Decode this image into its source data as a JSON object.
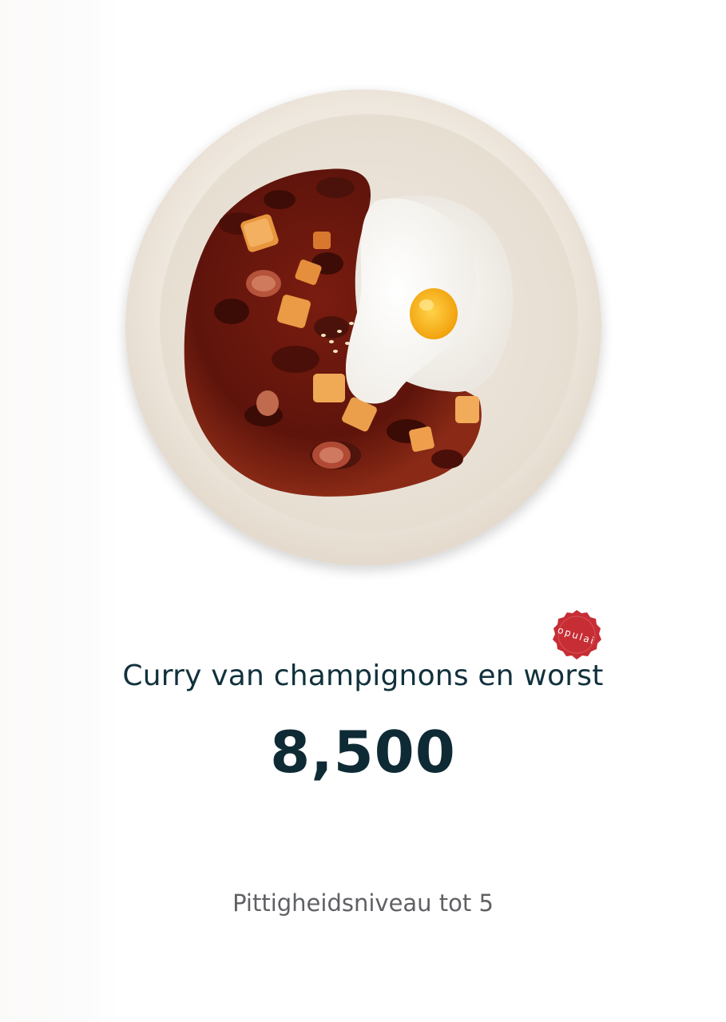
{
  "product": {
    "name": "Curry van champignons en worst",
    "price": "8,500",
    "spice_note": "Pittigheidsniveau tot 5"
  },
  "badge": {
    "text": "opulai",
    "color": "#c72d35"
  },
  "colors": {
    "title": "#11313c",
    "price": "#0e2b35",
    "spice": "#5f6164",
    "plate": "#ece5da"
  },
  "image": {
    "icon": "food-plate-photo"
  }
}
